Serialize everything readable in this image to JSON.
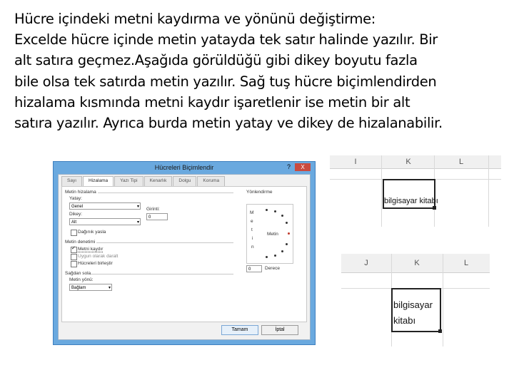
{
  "text_lines": [
    "Hücre içindeki metni kaydırma ve yönünü değiştirme:",
    "Excelde hücre içinde metin yatayda tek satır halinde yazılır. Bir",
    "alt satıra geçmez.Aşağıda görüldüğü gibi dikey boyutu fazla",
    "bile olsa tek satırda metin yazılır. Sağ tuş hücre biçimlendirden",
    "hizalama kısmında metni kaydır işaretlenir ise metin bir alt",
    "satıra yazılır. Ayrıca burda metin yatay ve dikey de hizalanabilir."
  ],
  "dialog": {
    "title": "Hücreleri Biçimlendir",
    "help": "?",
    "close": "X",
    "tabs": [
      "Sayı",
      "Hizalama",
      "Yazı Tipi",
      "Kenarlık",
      "Dolgu",
      "Koruma"
    ],
    "section_alignment": "Metin hizalama",
    "horizontal_label": "Yatay:",
    "horizontal_value": "Genel",
    "vertical_label": "Dikey:",
    "vertical_value": "Alt",
    "indent_label": "Girinti:",
    "indent_value": "0",
    "distributed": "Dağınık yasla",
    "section_control": "Metin denetimi",
    "wrap_text": "Metni kaydır",
    "shrink": "Uygun olarak daralt",
    "merge": "Hücreleri birleştir",
    "section_rtl": "Sağdan sola",
    "direction_label": "Metin yönü:",
    "direction_value": "Bağlam",
    "orientation_label": "Yönlendirme",
    "orientation_vertical": [
      "M",
      "e",
      "t",
      "i",
      "n"
    ],
    "orientation_text": "Metin",
    "degree_value": "0",
    "degree_label": "Derece",
    "ok": "Tamam",
    "cancel": "İptal"
  },
  "excel_top": {
    "columns": [
      "I",
      "K",
      "L"
    ],
    "cell_text": "bilgisayar kitabı"
  },
  "excel_bottom": {
    "columns": [
      "J",
      "K",
      "L"
    ],
    "cell_line1": "bilgisayar",
    "cell_line2": "kitabı"
  }
}
